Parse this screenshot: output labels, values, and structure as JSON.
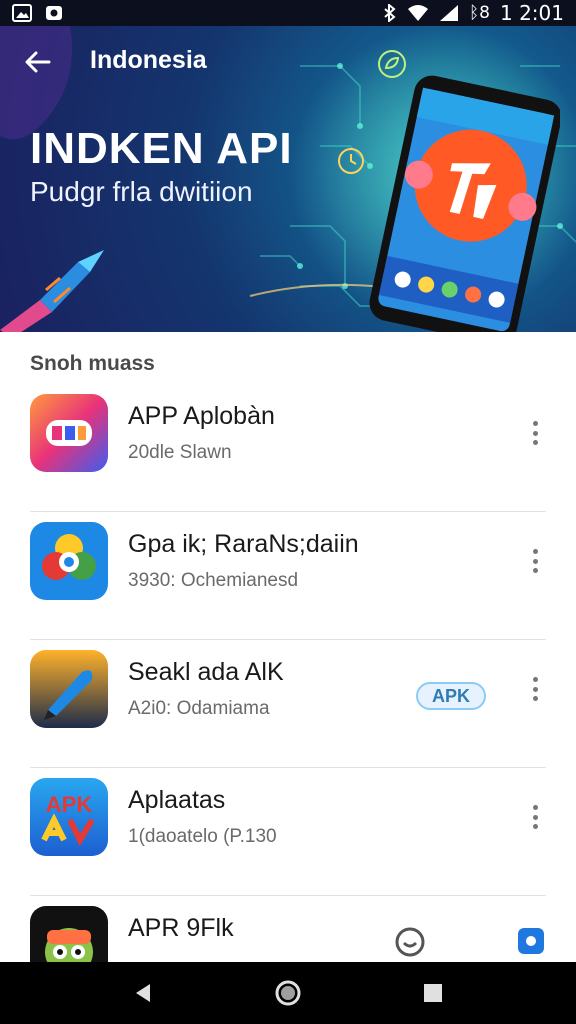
{
  "status_bar": {
    "time": "1 2:01",
    "signal_text": "ᛒ8",
    "icons": [
      "image-icon",
      "notification-icon",
      "bluetooth-icon",
      "wifi-icon",
      "signal-icon"
    ]
  },
  "hero": {
    "country": "Indonesia",
    "title": "INDKEN API",
    "subtitle": "Pudgr frla dwitiion",
    "colors": {
      "deep": "#1a2160",
      "teal": "#1e9ea6",
      "accent": "#ff5a26"
    }
  },
  "section": {
    "title": "Snoh muass"
  },
  "apps": [
    {
      "name": "APP Aplobàn",
      "meta": "20dle Slawn",
      "icon": "api-app-icon"
    },
    {
      "name": "Gpa ik; RaraNs;daiin",
      "meta": "3930: Ochemianesd",
      "icon": "photos-app-icon"
    },
    {
      "name": "Seakl ada AlK",
      "meta": "A2i0: Odamiama",
      "icon": "pen-app-icon",
      "badge": "APK"
    },
    {
      "name": "Aplaatas",
      "meta": "1(daoatelo (P.130",
      "icon": "apk-av-app-icon"
    },
    {
      "name": "APR 9Flk",
      "meta": "",
      "icon": "character-app-icon"
    }
  ],
  "nav": {
    "back": "back-icon",
    "home": "home-icon",
    "recents": "recents-icon"
  }
}
